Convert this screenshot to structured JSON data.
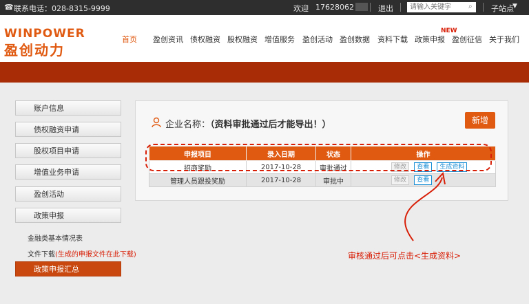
{
  "topbar": {
    "phone": "联系电话：028-8315-9999",
    "welcome": "欢迎",
    "user": "17628062",
    "logout": "退出",
    "search_placeholder": "请输入关键字",
    "substation": "子站点"
  },
  "brand": {
    "logo_en": "WINPOWER",
    "logo_cn": "盈创动力",
    "accent": "#e05a12"
  },
  "nav": {
    "items": [
      "首页",
      "盈创资讯",
      "债权融资",
      "股权融资",
      "增值服务",
      "盈创活动",
      "盈创数据",
      "资料下载",
      "政策申报",
      "盈创征信",
      "关于我们"
    ],
    "badge": "NEW"
  },
  "sidebar": {
    "items": [
      "账户信息",
      "债权融资申请",
      "股权项目申请",
      "增值业务申请",
      "盈创活动",
      "政策申报"
    ],
    "sub_financial": "金融类基本情况表",
    "sub_file_prefix": "文件下载",
    "sub_file_note": "(生成的申报文件在此下载)",
    "active_item": "政策申报汇总"
  },
  "panel": {
    "company_label": "企业名称：",
    "company_value": "（资料审批通过后才能导出！）",
    "add_button": "新增"
  },
  "table": {
    "headers": [
      "申报项目",
      "录入日期",
      "状态",
      "操作"
    ],
    "rows": [
      {
        "project": "招商奖励",
        "date": "2017-10-28",
        "status": "审批通过",
        "actions": [
          "修改",
          "查看",
          "生成资料"
        ]
      },
      {
        "project": "管理人员跟投奖励",
        "date": "2017-10-28",
        "status": "审批中",
        "actions": [
          "修改",
          "查看"
        ]
      }
    ]
  },
  "annotation": {
    "text": "审核通过后可点击<生成资料>",
    "color": "#d81e06"
  }
}
